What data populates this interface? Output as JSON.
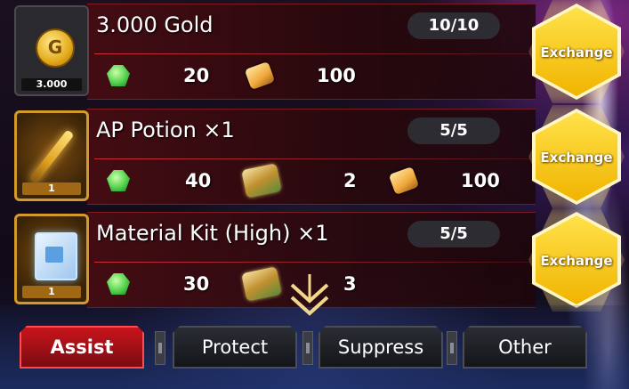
{
  "items": [
    {
      "icon": "gold-coin-icon",
      "icon_count": "3.000",
      "title": "3.000 Gold",
      "limit": "10/10",
      "costs": [
        {
          "icon": "green-gem-icon",
          "amount": "20"
        },
        {
          "icon": "gold-chip-icon",
          "amount": "100"
        }
      ],
      "button": "Exchange"
    },
    {
      "icon": "ap-potion-icon",
      "icon_count": "1",
      "title": "AP Potion ×1",
      "limit": "5/5",
      "costs": [
        {
          "icon": "green-gem-icon",
          "amount": "40"
        },
        {
          "icon": "supply-crate-icon",
          "amount": "2"
        },
        {
          "icon": "gold-chip-icon",
          "amount": "100"
        }
      ],
      "button": "Exchange"
    },
    {
      "icon": "material-kit-icon",
      "icon_count": "1",
      "title": "Material Kit (High) ×1",
      "limit": "5/5",
      "costs": [
        {
          "icon": "green-gem-icon",
          "amount": "30"
        },
        {
          "icon": "supply-crate-icon",
          "amount": "3"
        }
      ],
      "button": "Exchange"
    }
  ],
  "tabs": [
    {
      "label": "Assist",
      "active": true
    },
    {
      "label": "Protect",
      "active": false
    },
    {
      "label": "Suppress",
      "active": false
    },
    {
      "label": "Other",
      "active": false
    }
  ],
  "scroll_indicator": "chevron-down-icon"
}
